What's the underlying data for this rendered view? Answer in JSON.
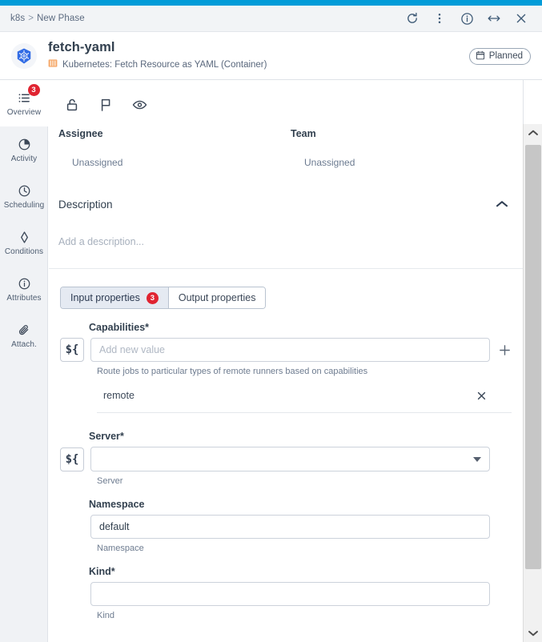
{
  "theme": {
    "accent": "#029cd8",
    "badge_red": "#e02431",
    "text_dark": "#32404f",
    "text_muted": "#6b7a90",
    "tab_active_bg": "#e5eaf2",
    "sidebar_bg": "#f0f2f5",
    "container_icon": "#f5a45a"
  },
  "titlebar": {
    "breadcrumb_root": "k8s",
    "breadcrumb_sep": ">",
    "breadcrumb_current": "New Phase",
    "actions": [
      {
        "name": "refresh-icon",
        "label": "Refresh"
      },
      {
        "name": "more-vertical-icon",
        "label": "More options"
      },
      {
        "name": "info-circle-icon",
        "label": "Info"
      },
      {
        "name": "resize-horizontal-icon",
        "label": "Resize"
      },
      {
        "name": "close-icon",
        "label": "Close"
      }
    ]
  },
  "header": {
    "logo": "kubernetes-logo",
    "title": "fetch-yaml",
    "subtitle_icon": "container-icon",
    "subtitle": "Kubernetes: Fetch Resource as YAML (Container)",
    "status": {
      "icon": "calendar-icon",
      "label": "Planned"
    }
  },
  "sidebar": {
    "items": [
      {
        "label": "Overview",
        "icon": "list-icon",
        "badge": "3",
        "active": true
      },
      {
        "label": "Activity",
        "icon": "pie-chart-icon",
        "badge": "",
        "active": false
      },
      {
        "label": "Scheduling",
        "icon": "clock-icon",
        "badge": "",
        "active": false
      },
      {
        "label": "Conditions",
        "icon": "diamond-icon",
        "badge": "",
        "active": false
      },
      {
        "label": "Attributes",
        "icon": "info-circle-icon",
        "badge": "",
        "active": false
      },
      {
        "label": "Attach.",
        "icon": "paperclip-icon",
        "badge": "",
        "active": false
      }
    ]
  },
  "object_toolbar": [
    {
      "name": "unlock-icon",
      "label": "Unlock"
    },
    {
      "name": "flag-icon",
      "label": "Flag"
    },
    {
      "name": "eye-icon",
      "label": "Watch"
    }
  ],
  "overview": {
    "assignee_label": "Assignee",
    "assignee_value": "Unassigned",
    "team_label": "Team",
    "team_value": "Unassigned",
    "description_label": "Description",
    "description_placeholder": "Add a description..."
  },
  "tabs": [
    {
      "label": "Input properties",
      "badge": "3",
      "active": true
    },
    {
      "label": "Output properties",
      "badge": "",
      "active": false
    }
  ],
  "form": {
    "capabilities": {
      "label": "Capabilities",
      "required": "*",
      "var_button": "${",
      "placeholder": "Add new value",
      "value": "",
      "hint": "Route jobs to particular types of remote runners based on capabilities",
      "add_icon": "plus-icon",
      "items": [
        {
          "label": "remote",
          "remove_icon": "close-icon"
        }
      ]
    },
    "server": {
      "label": "Server",
      "required": "*",
      "var_button": "${",
      "value": "",
      "hint": "Server"
    },
    "namespace": {
      "label": "Namespace",
      "required": "",
      "value": "default",
      "hint": "Namespace"
    },
    "kind": {
      "label": "Kind",
      "required": "*",
      "value": "",
      "hint": "Kind"
    }
  },
  "scrollbar": {
    "up_icon": "chevron-up-icon",
    "down_icon": "chevron-down-icon"
  }
}
